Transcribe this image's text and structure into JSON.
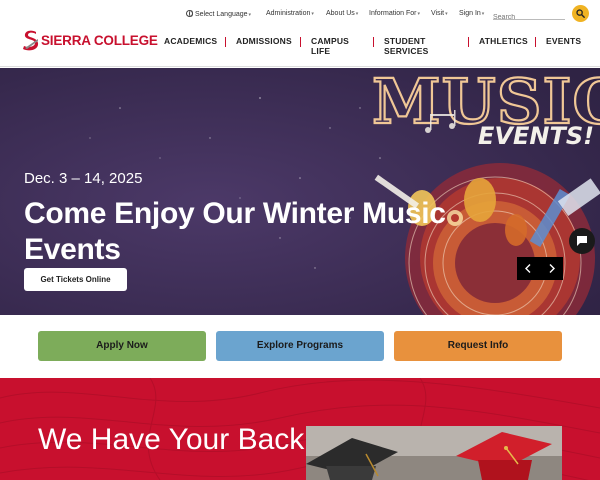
{
  "utility_nav": {
    "language": "Select Language",
    "items": [
      "Administration",
      "About Us",
      "Information For",
      "Visit",
      "Sign In"
    ],
    "search_placeholder": "Search"
  },
  "logo": {
    "text": "SIERRA COLLEGE"
  },
  "main_nav": {
    "items": [
      {
        "label": "ACADEMICS"
      },
      {
        "label": "ADMISSIONS"
      },
      {
        "label": "CAMPUS LIFE"
      },
      {
        "label": "STUDENT SERVICES"
      },
      {
        "label": "ATHLETICS"
      },
      {
        "label": "EVENTS"
      }
    ]
  },
  "hero": {
    "art_word_1": "MUSIC",
    "art_word_2": "EVENTS!",
    "date": "Dec. 3 – 14, 2025",
    "title": "Come Enjoy Our Winter Music Events",
    "cta": "Get Tickets Online"
  },
  "quick_links": [
    {
      "label": "Apply Now",
      "color": "#7dac5a"
    },
    {
      "label": "Explore Programs",
      "color": "#6ba4cf"
    },
    {
      "label": "Request Info",
      "color": "#e8913d"
    }
  ],
  "feature": {
    "title": "We Have Your Back"
  },
  "colors": {
    "brand_red": "#c8102e",
    "hero_purple": "#3d2d55",
    "search_yellow": "#f0b323"
  }
}
